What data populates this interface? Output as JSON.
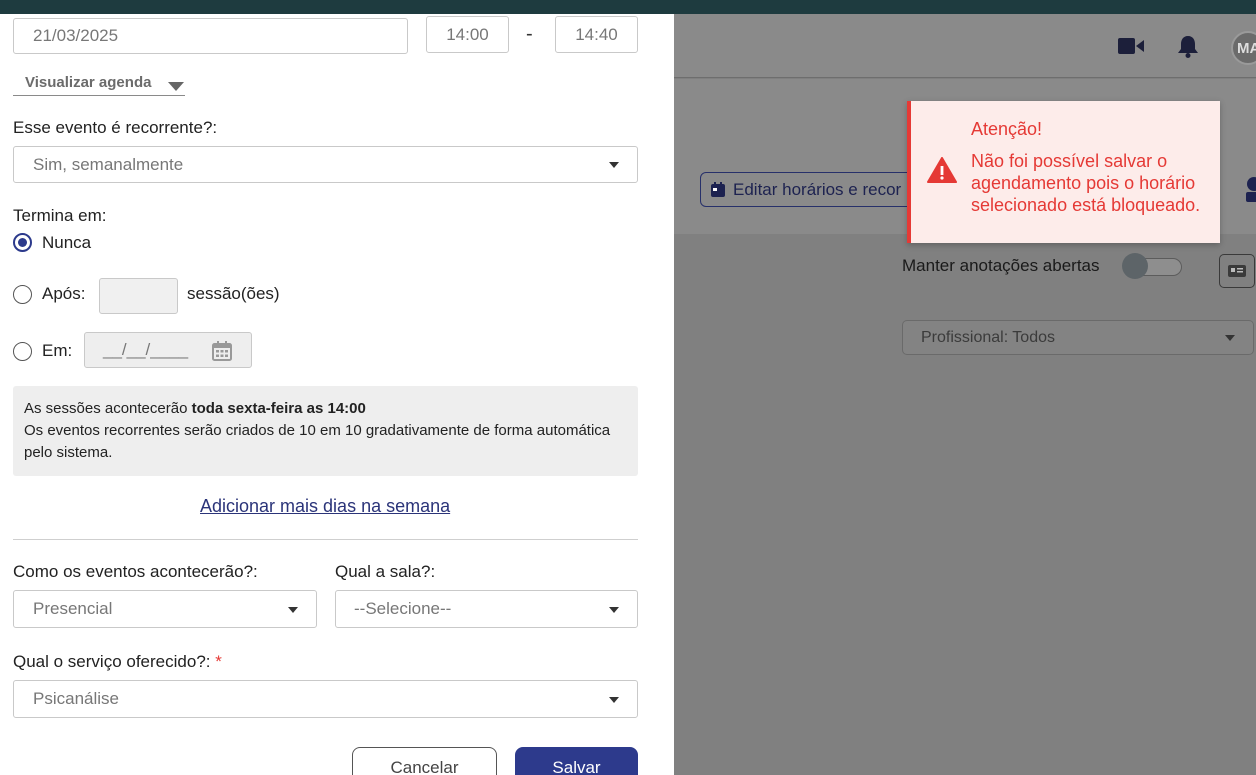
{
  "form": {
    "date_value": "21/03/2025",
    "start_time": "14:00",
    "time_separator": "-",
    "end_time": "14:40",
    "view_agenda_label": "Visualizar agenda",
    "recurring_label": "Esse evento é recorrente?:",
    "recurring_value": "Sim, semanalmente",
    "ends_label": "Termina em:",
    "ends_options": {
      "never": "Nunca",
      "after": "Após:",
      "after_suffix": "sessão(ões)",
      "on": "Em:",
      "on_placeholder": "__/__/____"
    },
    "ends_selected": "never",
    "info_line1_prefix": "As sessões acontecerão ",
    "info_line1_bold": "toda sexta-feira as 14:00",
    "info_line2": "Os eventos recorrentes serão criados de 10 em 10 gradativamente de forma automática pelo sistema.",
    "add_days_link": "Adicionar mais dias na semana",
    "how_label": "Como os eventos acontecerão?:",
    "how_value": "Presencial",
    "room_label": "Qual a sala?:",
    "room_value": "--Selecione--",
    "service_label": "Qual o serviço oferecido?:",
    "required_mark": "*",
    "service_value": "Psicanálise",
    "cancel_label": "Cancelar",
    "save_label": "Salvar"
  },
  "background": {
    "avatar_initials": "MA",
    "edit_hours_label": "Editar horários e recor",
    "keep_notes_label": "Manter anotações abertas",
    "professional_select": "Profissional: Todos"
  },
  "toast": {
    "title": "Atenção!",
    "message": "Não foi possível salvar o agendamento pois o horário selecionado está bloqueado."
  },
  "colors": {
    "primary": "#2d3a8c",
    "error": "#e53935",
    "toast_bg": "#fdecea"
  }
}
